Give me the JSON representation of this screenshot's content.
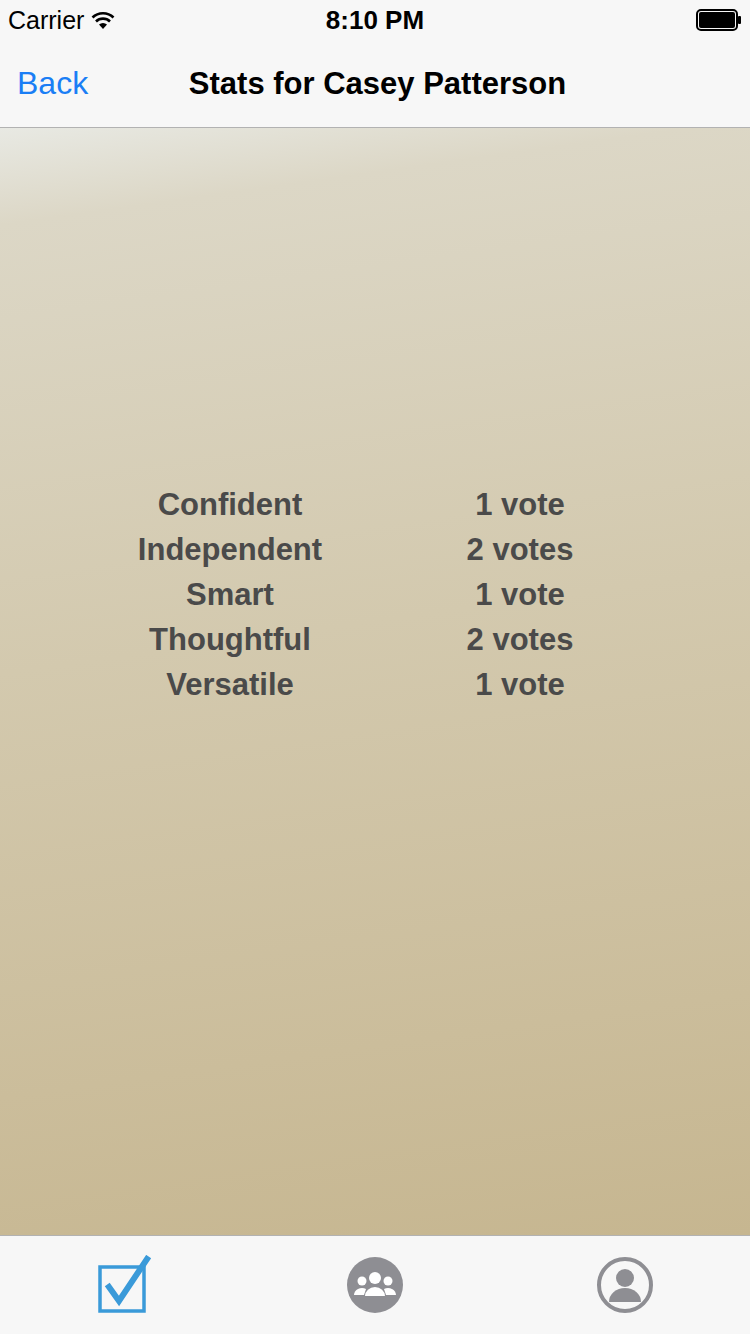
{
  "status_bar": {
    "carrier": "Carrier",
    "time": "8:10 PM",
    "battery_level": 1
  },
  "nav": {
    "back": "Back",
    "title": "Stats for Casey Patterson"
  },
  "stats": [
    {
      "trait": "Confident",
      "votes": "1 vote"
    },
    {
      "trait": "Independent",
      "votes": "2 votes"
    },
    {
      "trait": "Smart",
      "votes": "1 vote"
    },
    {
      "trait": "Thoughtful",
      "votes": "2 votes"
    },
    {
      "trait": "Versatile",
      "votes": "1 vote"
    }
  ],
  "tab_bar": [
    {
      "kind": "votes",
      "selected": true
    },
    {
      "kind": "friends",
      "selected": false
    },
    {
      "kind": "profile",
      "selected": false
    }
  ]
}
